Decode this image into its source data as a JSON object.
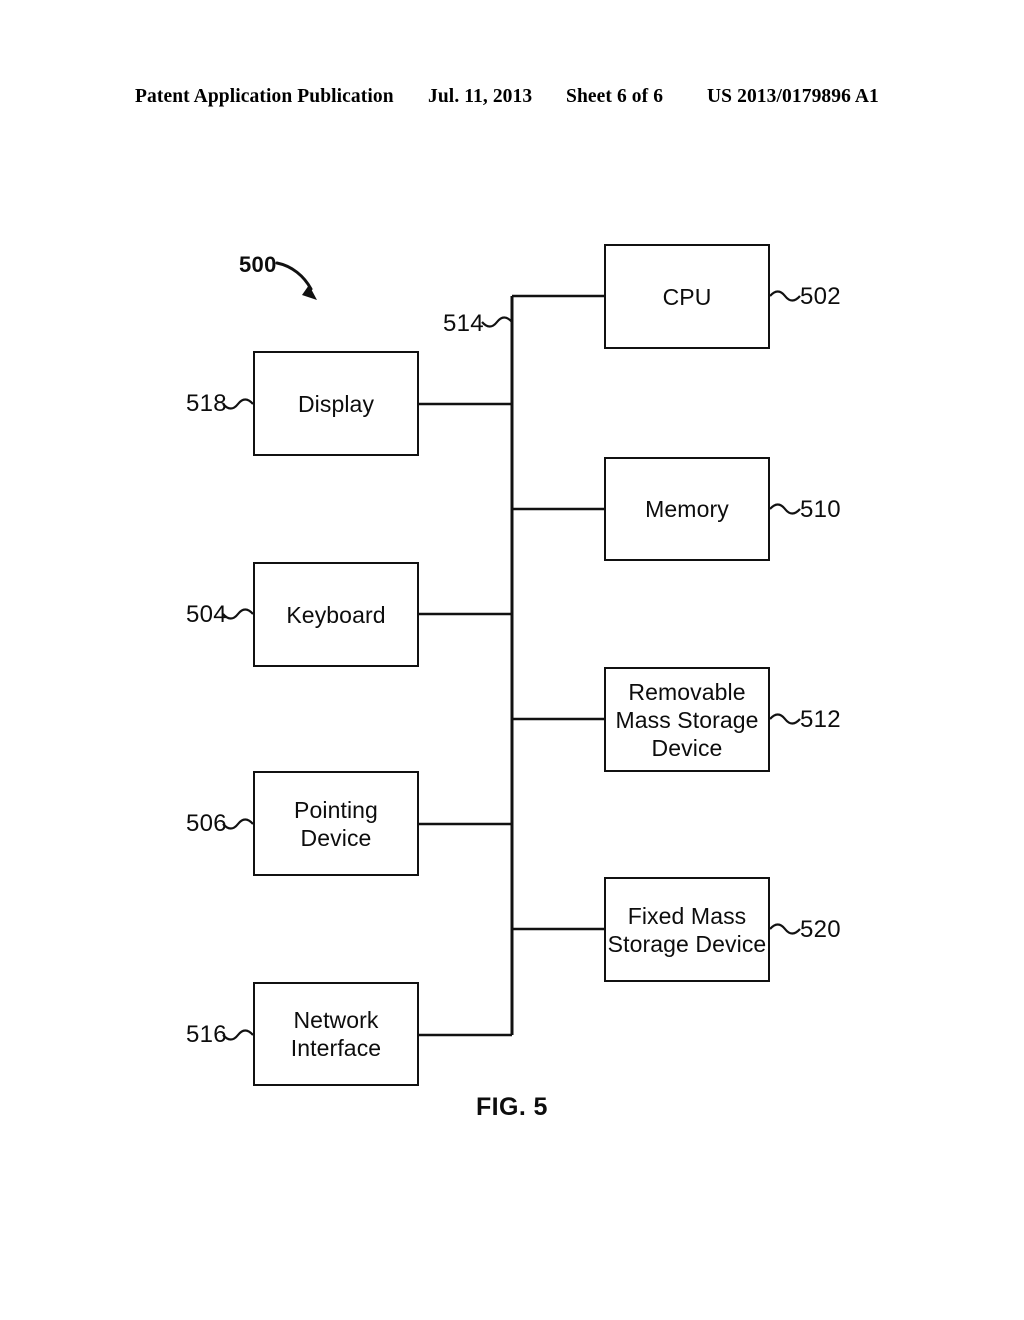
{
  "header": {
    "publication": "Patent Application Publication",
    "date": "Jul. 11, 2013",
    "sheet": "Sheet 6 of 6",
    "patent_number": "US 2013/0179896 A1"
  },
  "figure": {
    "caption": "FIG. 5",
    "system_label": "500",
    "bus_label": "514",
    "stroke_color": "#111111",
    "background_color": "#ffffff",
    "nodes": [
      {
        "id": "cpu",
        "label": "CPU",
        "ref": "502"
      },
      {
        "id": "memory",
        "label": "Memory",
        "ref": "510"
      },
      {
        "id": "removable",
        "label": "Removable\nMass Storage\nDevice",
        "ref": "512"
      },
      {
        "id": "fixed",
        "label": "Fixed Mass\nStorage Device",
        "ref": "520"
      },
      {
        "id": "display",
        "label": "Display",
        "ref": "518"
      },
      {
        "id": "keyboard",
        "label": "Keyboard",
        "ref": "504"
      },
      {
        "id": "pointing",
        "label": "Pointing\nDevice",
        "ref": "506"
      },
      {
        "id": "network",
        "label": "Network\nInterface",
        "ref": "516"
      }
    ]
  }
}
